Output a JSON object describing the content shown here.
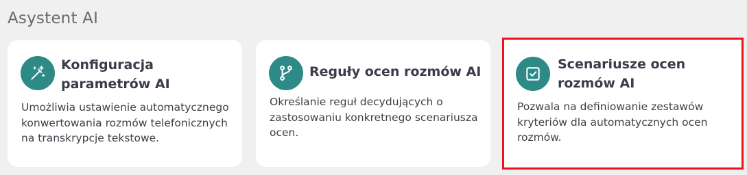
{
  "section": {
    "title": "Asystent AI"
  },
  "cards": [
    {
      "title": "Konfiguracja parametrów AI",
      "description": "Umożliwia ustawienie automatycznego konwertowania rozmów telefonicznych na transkrypcje tekstowe.",
      "icon": "magic-wand-icon"
    },
    {
      "title": "Reguły ocen rozmów AI",
      "description": "Określanie reguł decydujących o zastosowaniu konkretnego scenariusza ocen.",
      "icon": "branch-icon"
    },
    {
      "title": "Scenariusze ocen rozmów AI",
      "description": "Pozwala na definiowanie zestawów kryteriów dla automatycznych ocen rozmów.",
      "icon": "checkbox-icon",
      "highlighted": true
    }
  ],
  "colors": {
    "background": "#f0f0f0",
    "card": "#ffffff",
    "icon_circle": "#2e8a86",
    "highlight_border": "#e8141c",
    "title_text": "#3b3b4a",
    "section_title_text": "#6a6a6a"
  }
}
